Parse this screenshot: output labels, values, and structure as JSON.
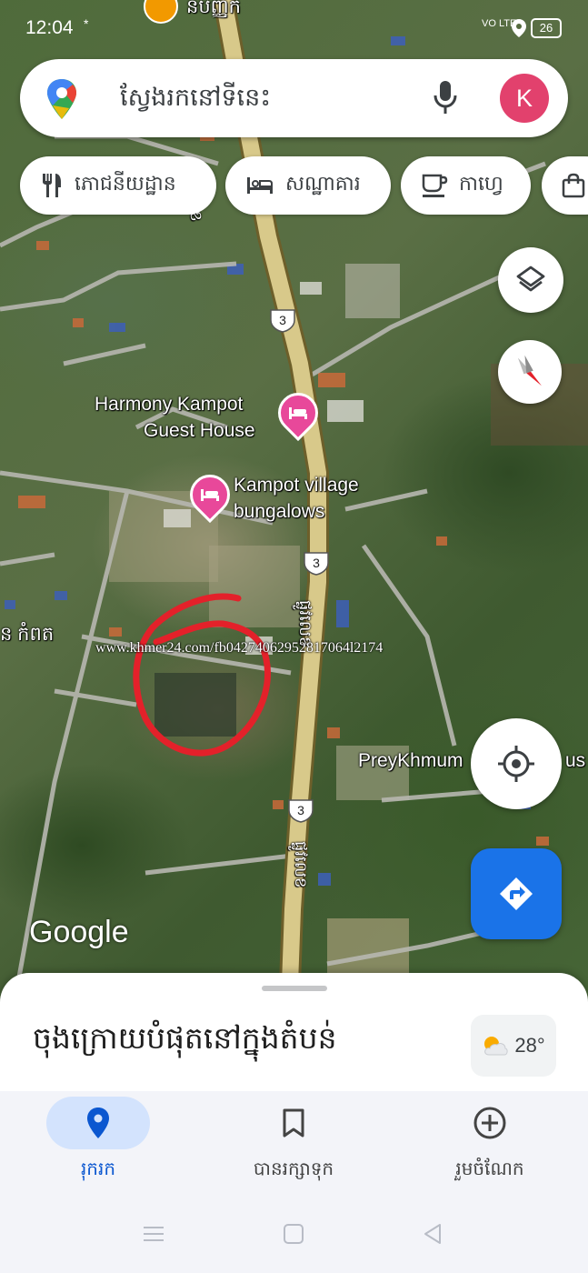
{
  "status_bar": {
    "time": "12:04",
    "network": "VO LTE",
    "battery": "26"
  },
  "search": {
    "placeholder": "ស្វែងរកនៅទីនេះ",
    "avatar_letter": "K"
  },
  "chips": [
    {
      "label": "ភោជនីយដ្ឋាន",
      "icon": "restaurant-icon"
    },
    {
      "label": "សណ្ឋាគារ",
      "icon": "hotel-icon"
    },
    {
      "label": "កាហ្វេ",
      "icon": "coffee-icon"
    },
    {
      "label": "",
      "icon": "shopping-bag-icon"
    }
  ],
  "map": {
    "labels": {
      "top_partial": "នបញ្ញក",
      "harmony_line1": "Harmony Kampot",
      "harmony_line2": "Guest House",
      "village_line1": "Kampot village",
      "village_line2": "bungalows",
      "left_partial": "ន កំពត",
      "preykhmum": "PreyKhmum",
      "preykhmum_suffix": "us",
      "road_upper": "ផ្លូវលេខ",
      "road_lower": "ផ្លូវលេខ"
    },
    "route_number": "3",
    "watermark": "www.khmer24.com/fb04274062952817064l2174",
    "google_logo": "Google"
  },
  "bottom_sheet": {
    "title": "ចុងក្រោយបំផុតនៅក្នុងតំបន់",
    "temperature": "28°"
  },
  "bottom_nav": [
    {
      "label": "រុករក",
      "icon": "explore-pin-icon",
      "active": true
    },
    {
      "label": "បានរក្សាទុក",
      "icon": "bookmark-icon",
      "active": false
    },
    {
      "label": "រួមចំណែក",
      "icon": "add-circle-icon",
      "active": false
    }
  ],
  "colors": {
    "accent": "#1a73e8",
    "avatar": "#e2416d",
    "pin": "#e8489a",
    "nav_active_bg": "#d3e3fd"
  }
}
